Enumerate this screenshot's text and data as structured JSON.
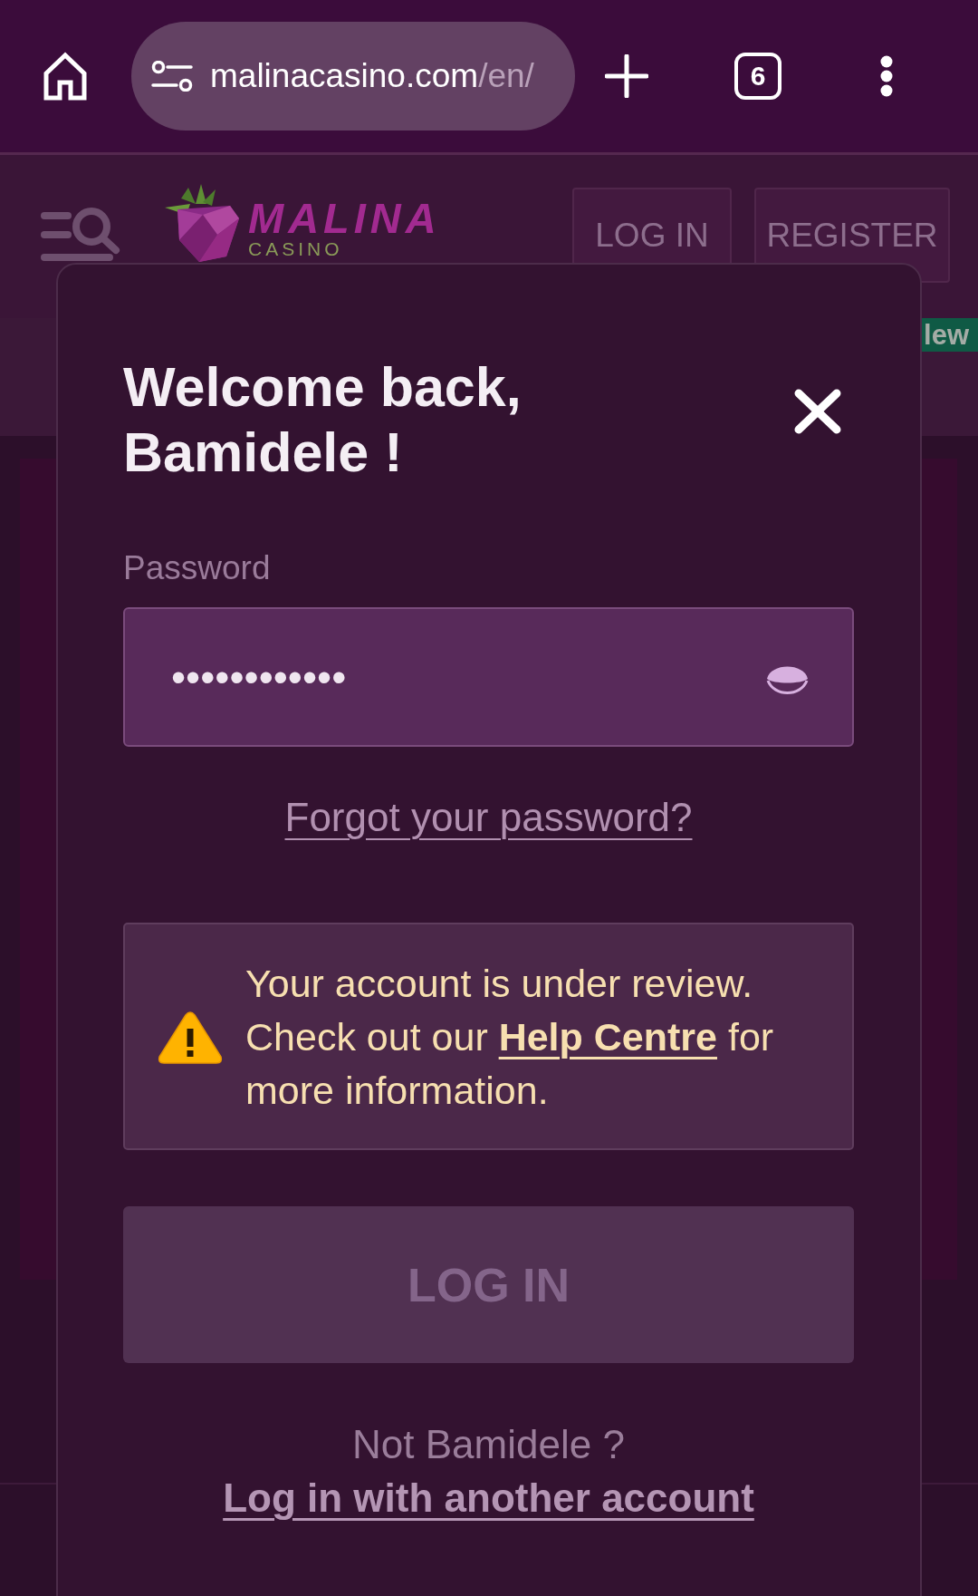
{
  "browser": {
    "url": {
      "host": "malinacasino.com",
      "path": "/en/"
    },
    "tab_count": "6"
  },
  "site_header": {
    "logo": {
      "wordmark": "MALINA",
      "subtitle": "CASINO"
    },
    "buttons": [
      {
        "label": "LOG IN"
      },
      {
        "label": "REGISTER"
      }
    ],
    "badge": "lew"
  },
  "modal": {
    "title_lines": [
      "Welcome back,",
      "Bamidele !"
    ],
    "password": {
      "label": "Password",
      "value": "••••••••••••"
    },
    "forgot_link": "Forgot your password?",
    "alert": {
      "kind": "warning",
      "text_before": "Your account is under review. Check out our",
      "link": "Help Centre",
      "text_after": "for more information."
    },
    "submit": {
      "label": "LOG IN",
      "disabled": true
    },
    "not_user": "Not Bamidele ?",
    "switch_link": "Log in with another account"
  }
}
